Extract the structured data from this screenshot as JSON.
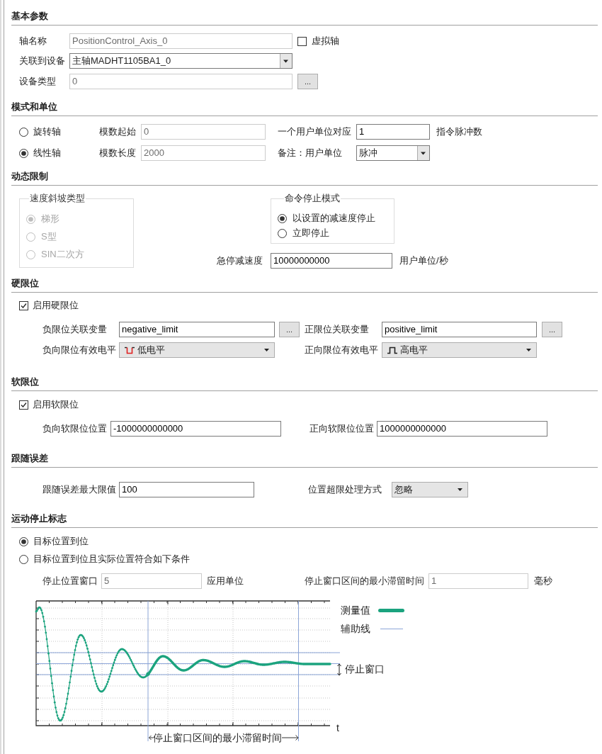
{
  "basic_params": {
    "title": "基本参数",
    "axis_name": {
      "label": "轴名称",
      "value": "PositionControl_Axis_0",
      "disabled": true
    },
    "virtual_axis": {
      "label": "虚拟轴",
      "checked": false
    },
    "device": {
      "label": "关联到设备",
      "value": "主轴MADHT1105BA1_0"
    },
    "device_type": {
      "label": "设备类型",
      "value": "0",
      "disabled": true,
      "button": "..."
    }
  },
  "mode_units": {
    "title": "模式和单位",
    "axis_types": [
      {
        "label": "旋转轴",
        "selected": false
      },
      {
        "label": "线性轴",
        "selected": true
      }
    ],
    "modulo_fields": [
      {
        "label": "模数起始",
        "value": "0",
        "disabled": true
      },
      {
        "label": "模数长度",
        "value": "2000",
        "disabled": true
      }
    ],
    "pulses_per_unit": {
      "label": "一个用户单位对应",
      "value": "1",
      "unit": "指令脉冲数"
    },
    "user_unit": {
      "label": "备注：用户单位",
      "value": "脉冲"
    }
  },
  "dynamic_limits": {
    "title": "动态限制",
    "ramp_type": {
      "title": "速度斜坡类型",
      "disabled": true,
      "options": [
        {
          "label": "梯形",
          "selected": true
        },
        {
          "label": "S型",
          "selected": false
        },
        {
          "label": "SIN二次方",
          "selected": false
        }
      ]
    },
    "stop_mode": {
      "title": "命令停止模式",
      "options": [
        {
          "label": "以设置的减速度停止",
          "selected": true
        },
        {
          "label": "立即停止",
          "selected": false
        }
      ]
    },
    "emergency_decel": {
      "label": "急停减速度",
      "value": "10000000000",
      "unit": "用户单位/秒"
    }
  },
  "hard_limits": {
    "title": "硬限位",
    "enable": {
      "label": "启用硬限位",
      "checked": true
    },
    "negative_variable": {
      "label": "负限位关联变量",
      "value": "negative_limit",
      "button": "..."
    },
    "positive_variable": {
      "label": "正限位关联变量",
      "value": "positive_limit",
      "button": "..."
    },
    "negative_level": {
      "label": "负向限位有效电平",
      "value": "低电平",
      "kind": "low"
    },
    "positive_level": {
      "label": "正向限位有效电平",
      "value": "高电平",
      "kind": "high"
    }
  },
  "soft_limits": {
    "title": "软限位",
    "enable": {
      "label": "启用软限位",
      "checked": true
    },
    "negative_position": {
      "label": "负向软限位位置",
      "value": "-1000000000000"
    },
    "positive_position": {
      "label": "正向软限位位置",
      "value": "1000000000000"
    }
  },
  "following_error": {
    "title": "跟随误差",
    "max_value": {
      "label": "跟随误差最大限值",
      "value": "100"
    },
    "overflow_handling": {
      "label": "位置超限处理方式",
      "value": "忽略"
    }
  },
  "motion_stop_flag": {
    "title": "运动停止标志",
    "options": [
      {
        "label": "目标位置到位",
        "selected": true
      },
      {
        "label": "目标位置到位且实际位置符合如下条件",
        "selected": false
      }
    ],
    "stop_window": {
      "label": "停止位置窗口",
      "value": "5",
      "unit": "应用单位",
      "disabled": true
    },
    "min_dwell": {
      "label": "停止窗口区间的最小滞留时间",
      "value": "1",
      "unit": "毫秒",
      "disabled": true
    },
    "diagram": {
      "legend": [
        {
          "label": "测量值",
          "kind": "measured",
          "color": "#1ba37e"
        },
        {
          "label": "辅助线",
          "kind": "guide",
          "color": "#8ca5d8"
        }
      ],
      "window_label": "停止窗口",
      "axis_label": "t",
      "dwell_label": "停止窗口区间的最小滞留时间"
    }
  }
}
